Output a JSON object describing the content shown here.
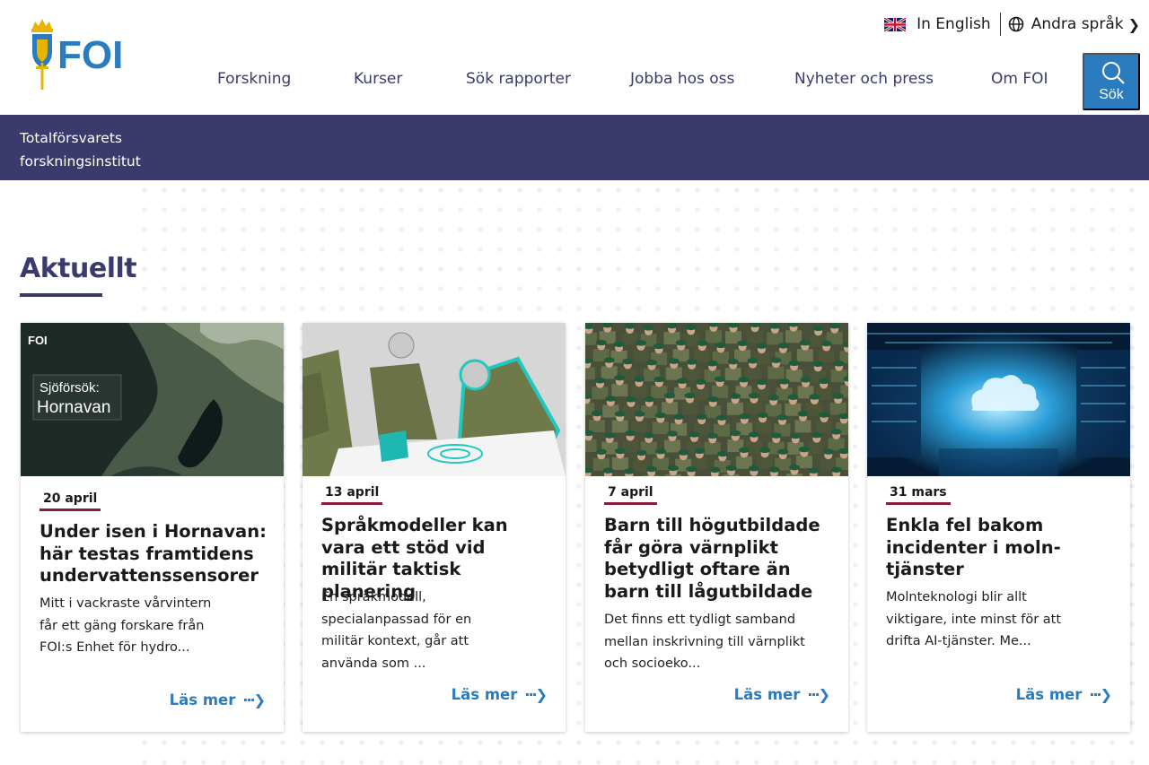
{
  "header": {
    "lang_english": "In English",
    "lang_other": "Andra språk",
    "nav": [
      "Forskning",
      "Kurser",
      "Sök rapporter",
      "Jobba hos oss",
      "Nyheter och press",
      "Om FOI"
    ],
    "search_label": "Sök",
    "logo_text": "FOI"
  },
  "banner": {
    "line1": "Totalförsvarets",
    "line2": "forskningsinstitut"
  },
  "section": {
    "title": "Aktuellt"
  },
  "cards": [
    {
      "date": "20 april",
      "title": "Under isen i Hornavan: här testas framtidens undervattenssensorer",
      "desc": "Mitt i vackraste vårvintern får ett gäng forskare från FOI:s Enhet för hydro...",
      "read_more": "Läs mer",
      "image_caption_1": "Sjöförsök:",
      "image_caption_2": "Hornavan",
      "image_logo": "FOI"
    },
    {
      "date": "13 april",
      "title": "Språkmodeller kan vara ett stöd vid militär taktisk planering",
      "desc": "En språkmodell, specialanpassad för en militär kontext, går att använda som ...",
      "read_more": "Läs mer"
    },
    {
      "date": "7 april",
      "title": "Barn till högutbildade får göra värnplikt betydligt oftare än barn till lågutbildade",
      "desc": "Det finns ett tydligt samband mellan inskrivning till värnplikt och socioeko...",
      "read_more": "Läs mer"
    },
    {
      "date": "31 mars",
      "title": "Enkla fel bakom incidenter i moln-tjänster",
      "desc": "Molnteknologi blir allt viktigare, inte minst för att drifta AI-tjänster. Me...",
      "read_more": "Läs mer"
    }
  ],
  "colors": {
    "brand_navy": "#3b3a6d",
    "link_blue": "#2b7bbf",
    "date_underline": "#8a1c3c",
    "logo_blue": "#2b7bbf",
    "logo_gold": "#e8b400"
  },
  "icons": [
    "uk-flag-icon",
    "globe-icon",
    "chevron-right-icon",
    "search-icon",
    "arrow-right-icon"
  ]
}
